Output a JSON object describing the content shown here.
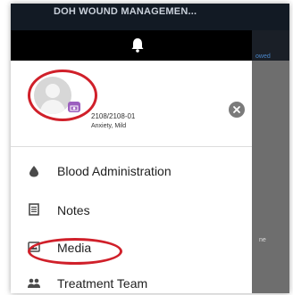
{
  "app": {
    "title": "DOH WOUND MANAGEMEN..."
  },
  "right_panel": {
    "link_snip": "owed",
    "text_snip": "ne"
  },
  "profile": {
    "patient_id": "2108/2108-01",
    "diagnosis": "Anxiety, Mild"
  },
  "menu": {
    "items": [
      {
        "label": "Blood Administration",
        "icon": "blood-drop-icon"
      },
      {
        "label": "Notes",
        "icon": "notes-icon"
      },
      {
        "label": "Media",
        "icon": "media-icon"
      },
      {
        "label": "Treatment Team",
        "icon": "team-icon"
      }
    ]
  },
  "colors": {
    "topbar": "#121a24",
    "bellbar": "#000000",
    "annotation": "#d0202a",
    "camera_badge": "#9c5fbf",
    "overlay": "#6e6e6e"
  }
}
